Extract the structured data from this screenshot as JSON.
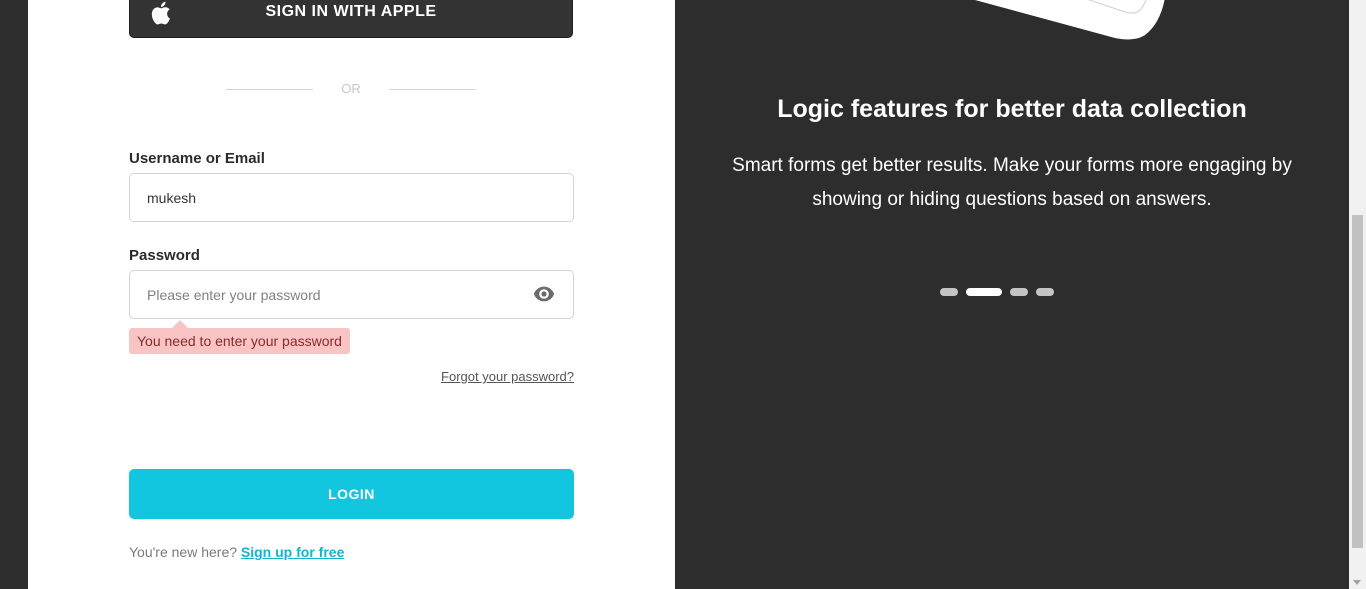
{
  "auth": {
    "apple_button_label": "SIGN IN WITH APPLE",
    "divider_text": "OR",
    "username_label": "Username or Email",
    "username_value": "mukesh",
    "password_label": "Password",
    "password_placeholder": "Please enter your password",
    "password_error": "You need to enter your password",
    "forgot_password": "Forgot your password?",
    "login_button": "LOGIN",
    "signup_prompt": "You're new here?",
    "signup_link": "Sign up for free"
  },
  "carousel": {
    "title": "Logic features for better data collection",
    "description": "Smart forms get better results. Make your forms more engaging by showing or hiding questions based on answers.",
    "slide_count": 4,
    "active_slide": 2
  },
  "icons": {
    "apple": "apple-icon",
    "eye": "eye-icon"
  },
  "colors": {
    "accent": "#13c6df",
    "dark_panel": "#2d2d2d",
    "error_bg": "#f9c4c4"
  }
}
